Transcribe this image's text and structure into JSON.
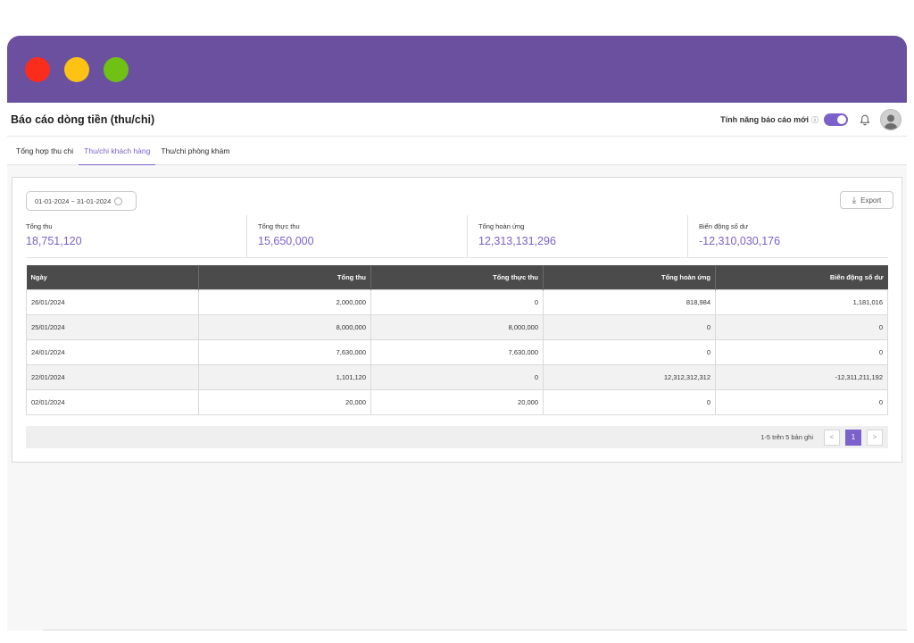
{
  "app": {
    "title": "Báo cáo dòng tiền (thu/chi)",
    "feature_label": "Tính năng báo cáo mới",
    "info_icon": "info-icon",
    "toggle_on": true
  },
  "tabs": [
    {
      "label": "Tổng hợp thu chi",
      "active": false
    },
    {
      "label": "Thu/chi khách hàng",
      "active": true
    },
    {
      "label": "Thu/chi phòng khám",
      "active": false
    }
  ],
  "filter": {
    "date_range": "01-01-2024 ~ 31-01-2024"
  },
  "toolbar": {
    "export_label": "Export"
  },
  "stats": [
    {
      "label": "Tổng thu",
      "value": "18,751,120"
    },
    {
      "label": "Tổng thực thu",
      "value": "15,650,000"
    },
    {
      "label": "Tổng hoàn ứng",
      "value": "12,313,131,296"
    },
    {
      "label": "Biến động số dư",
      "value": "-12,310,030,176"
    }
  ],
  "table": {
    "headers": [
      "Ngày",
      "Tổng thu",
      "Tổng thực thu",
      "Tổng hoàn ứng",
      "Biến động số dư"
    ],
    "rows": [
      [
        "26/01/2024",
        "2,000,000",
        "0",
        "818,984",
        "1,181,016"
      ],
      [
        "25/01/2024",
        "8,000,000",
        "8,000,000",
        "0",
        "0"
      ],
      [
        "24/01/2024",
        "7,630,000",
        "7,630,000",
        "0",
        "0"
      ],
      [
        "22/01/2024",
        "1,101,120",
        "0",
        "12,312,312,312",
        "-12,311,211,192"
      ],
      [
        "02/01/2024",
        "20,000",
        "20,000",
        "0",
        "0"
      ]
    ]
  },
  "pagination": {
    "info": "1-5 trên 5 bản ghi",
    "prev": "<",
    "current": "1",
    "next": ">"
  },
  "colors": {
    "titlebar": "#6b50a0",
    "accent": "#7b61c9",
    "table_header": "#4b4b4b"
  }
}
